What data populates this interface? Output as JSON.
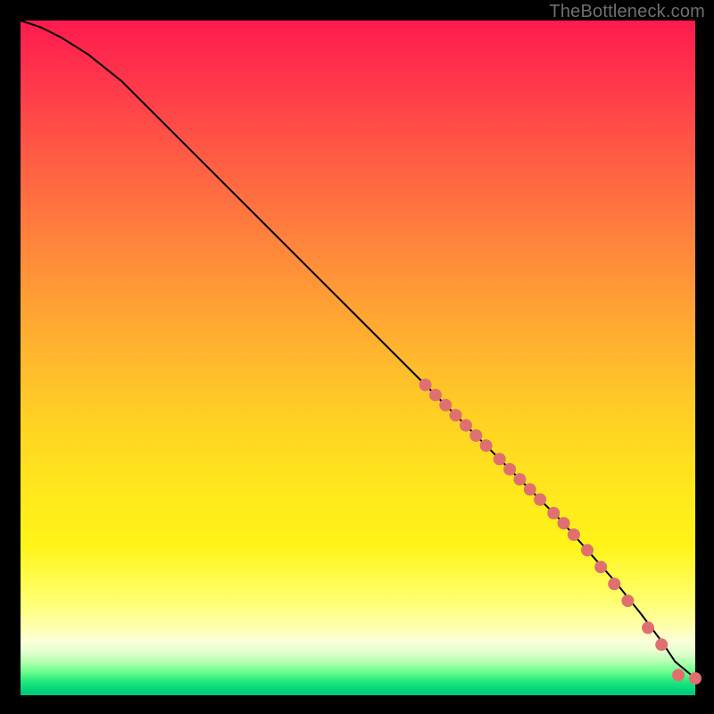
{
  "attribution": "TheBottleneck.com",
  "chart_data": {
    "type": "line",
    "title": "",
    "xlabel": "",
    "ylabel": "",
    "xlim": [
      0,
      100
    ],
    "ylim": [
      0,
      100
    ],
    "series": [
      {
        "name": "curve",
        "x": [
          0,
          3,
          6,
          10,
          15,
          20,
          30,
          40,
          50,
          60,
          70,
          80,
          88,
          92,
          95,
          97,
          100
        ],
        "y": [
          100,
          99,
          97.5,
          95,
          91,
          86,
          76,
          66,
          56,
          46,
          36,
          26,
          17,
          12,
          8,
          5,
          2.5
        ]
      }
    ],
    "points": [
      {
        "x": 60.0,
        "y": 46.0
      },
      {
        "x": 61.5,
        "y": 44.5
      },
      {
        "x": 63.0,
        "y": 43.0
      },
      {
        "x": 64.5,
        "y": 41.5
      },
      {
        "x": 66.0,
        "y": 40.0
      },
      {
        "x": 67.5,
        "y": 38.5
      },
      {
        "x": 69.0,
        "y": 37.0
      },
      {
        "x": 71.0,
        "y": 35.0
      },
      {
        "x": 72.5,
        "y": 33.5
      },
      {
        "x": 74.0,
        "y": 32.0
      },
      {
        "x": 75.5,
        "y": 30.5
      },
      {
        "x": 77.0,
        "y": 29.0
      },
      {
        "x": 79.0,
        "y": 27.0
      },
      {
        "x": 80.5,
        "y": 25.5
      },
      {
        "x": 82.0,
        "y": 23.8
      },
      {
        "x": 84.0,
        "y": 21.5
      },
      {
        "x": 86.0,
        "y": 19.0
      },
      {
        "x": 88.0,
        "y": 16.5
      },
      {
        "x": 90.0,
        "y": 14.0
      },
      {
        "x": 93.0,
        "y": 10.0
      },
      {
        "x": 95.0,
        "y": 7.5
      },
      {
        "x": 97.5,
        "y": 3.0
      },
      {
        "x": 100.0,
        "y": 2.5
      }
    ],
    "point_color": "#e07070",
    "point_radius": 7,
    "curve_color": "#000000",
    "curve_width": 2
  }
}
